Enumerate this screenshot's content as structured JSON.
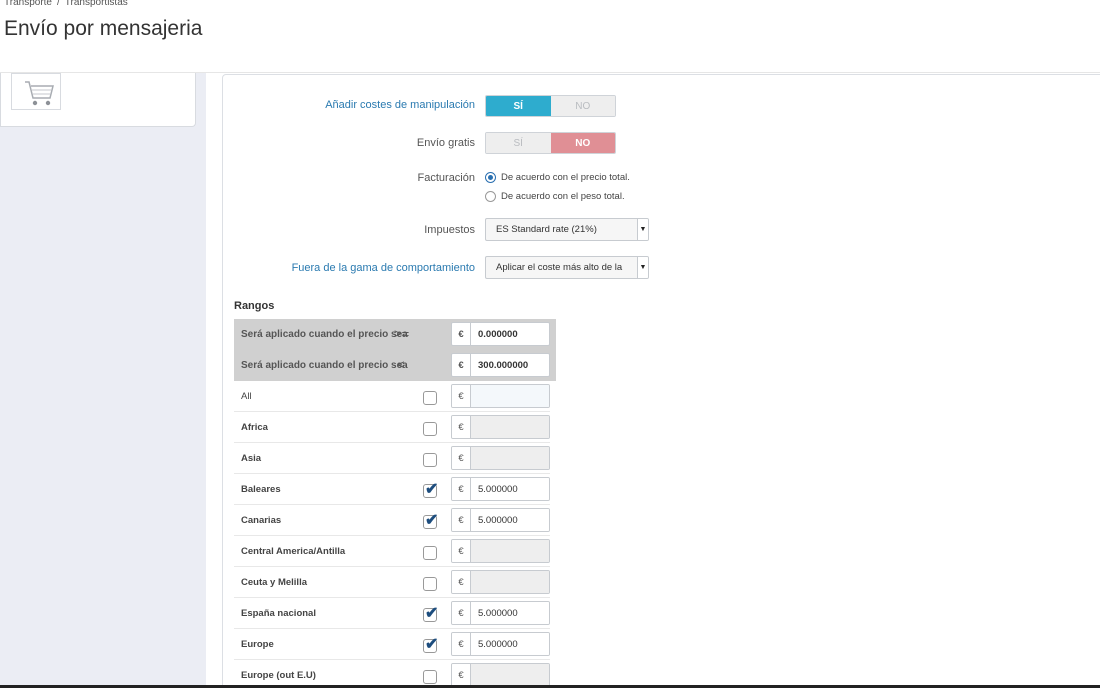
{
  "breadcrumb": {
    "item1": "Transporte",
    "separator": "/",
    "item2": "Transportistas"
  },
  "page_title": "Envío por mensajeria",
  "form": {
    "handling": {
      "label": "Añadir costes de manipulación",
      "yes": "SÍ",
      "no": "NO",
      "value": "yes"
    },
    "free_shipping": {
      "label": "Envío gratis",
      "yes": "SÍ",
      "no": "NO",
      "value": "no"
    },
    "billing": {
      "label": "Facturación",
      "options": [
        "De acuerdo con el precio total.",
        "De acuerdo con el peso total."
      ],
      "selected": 0
    },
    "tax": {
      "label": "Impuestos",
      "value": "ES Standard rate (21%)"
    },
    "out_of_range": {
      "label": "Fuera de la gama de comportamiento",
      "value": "Aplicar el coste más alto de la"
    }
  },
  "ranges": {
    "title": "Rangos",
    "lower": {
      "label": "Será aplicado cuando el precio sea",
      "op": ">=",
      "currency": "€",
      "value": "0.000000"
    },
    "upper": {
      "label": "Será aplicado cuando el precio sea",
      "op": "<",
      "currency": "€",
      "value": "300.000000"
    },
    "zones": [
      {
        "name": "All",
        "checked": false,
        "currency": "€",
        "value": ""
      },
      {
        "name": "Africa",
        "checked": false,
        "currency": "€",
        "value": ""
      },
      {
        "name": "Asia",
        "checked": false,
        "currency": "€",
        "value": ""
      },
      {
        "name": "Baleares",
        "checked": true,
        "currency": "€",
        "value": "5.000000"
      },
      {
        "name": "Canarias",
        "checked": true,
        "currency": "€",
        "value": "5.000000"
      },
      {
        "name": "Central America/Antilla",
        "checked": false,
        "currency": "€",
        "value": ""
      },
      {
        "name": "Ceuta y Melilla",
        "checked": false,
        "currency": "€",
        "value": ""
      },
      {
        "name": "España nacional",
        "checked": true,
        "currency": "€",
        "value": "5.000000"
      },
      {
        "name": "Europe",
        "checked": true,
        "currency": "€",
        "value": "5.000000"
      },
      {
        "name": "Europe (out E.U)",
        "checked": false,
        "currency": "€",
        "value": ""
      }
    ]
  },
  "colors": {
    "switch_yes": "#2eacce",
    "switch_no": "#e08f95",
    "help_label": "#2a7ab0"
  }
}
